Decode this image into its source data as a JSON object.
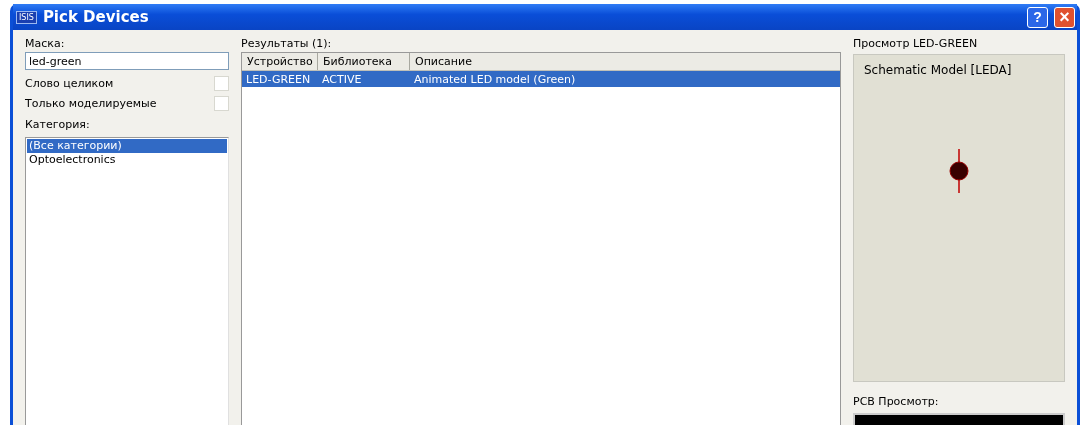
{
  "window": {
    "title": "Pick Devices",
    "icon_text": "ISIS",
    "help": "?",
    "close": "×"
  },
  "mask": {
    "label": "Маска:",
    "value": "led-green"
  },
  "options": [
    {
      "label": "Слово целиком",
      "checked": false
    },
    {
      "label": "Только моделируемые",
      "checked": false
    }
  ],
  "category": {
    "label": "Категория:",
    "items": [
      {
        "label": "(Все категории)",
        "selected": true
      },
      {
        "label": "Optoelectronics",
        "selected": false
      }
    ]
  },
  "results": {
    "label": "Результаты (1):",
    "columns": [
      "Устройство",
      "Библиотека",
      "Описание"
    ],
    "rows": [
      {
        "cells": [
          "LED-GREEN",
          "ACTIVE",
          "Animated LED model (Green)"
        ],
        "selected": true
      }
    ]
  },
  "preview": {
    "label": "Просмотр LED-GREEN",
    "model": "Schematic Model [LEDA]"
  },
  "pcb": {
    "label": "PCB Просмотр:"
  }
}
